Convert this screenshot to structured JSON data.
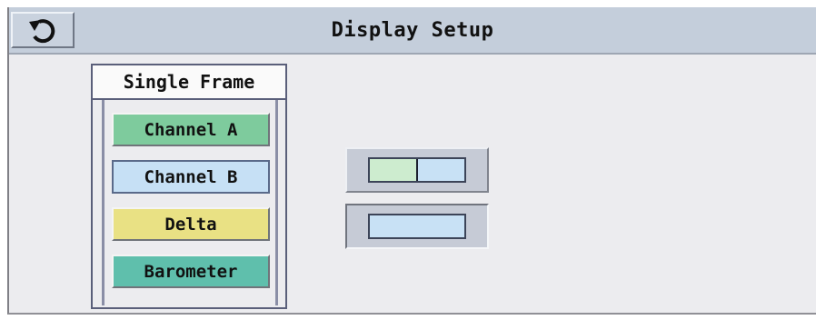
{
  "window": {
    "title": "Display Setup"
  },
  "icons": {
    "back": "undo-arrow-icon",
    "split_layout": "two-frame-layout-icon",
    "single_layout": "single-frame-layout-icon"
  },
  "panel": {
    "header": "Single Frame",
    "buttons": [
      {
        "label": "Channel A",
        "color": "#7ecb9d"
      },
      {
        "label": "Channel B",
        "color": "#c6e0f5"
      },
      {
        "label": "Delta",
        "color": "#e9e184"
      },
      {
        "label": "Barometer",
        "color": "#5fbfac"
      }
    ]
  },
  "layout_options": {
    "split_colors": [
      "#cdeccf",
      "#c8e1f5"
    ],
    "single_color": "#c8e1f5"
  }
}
